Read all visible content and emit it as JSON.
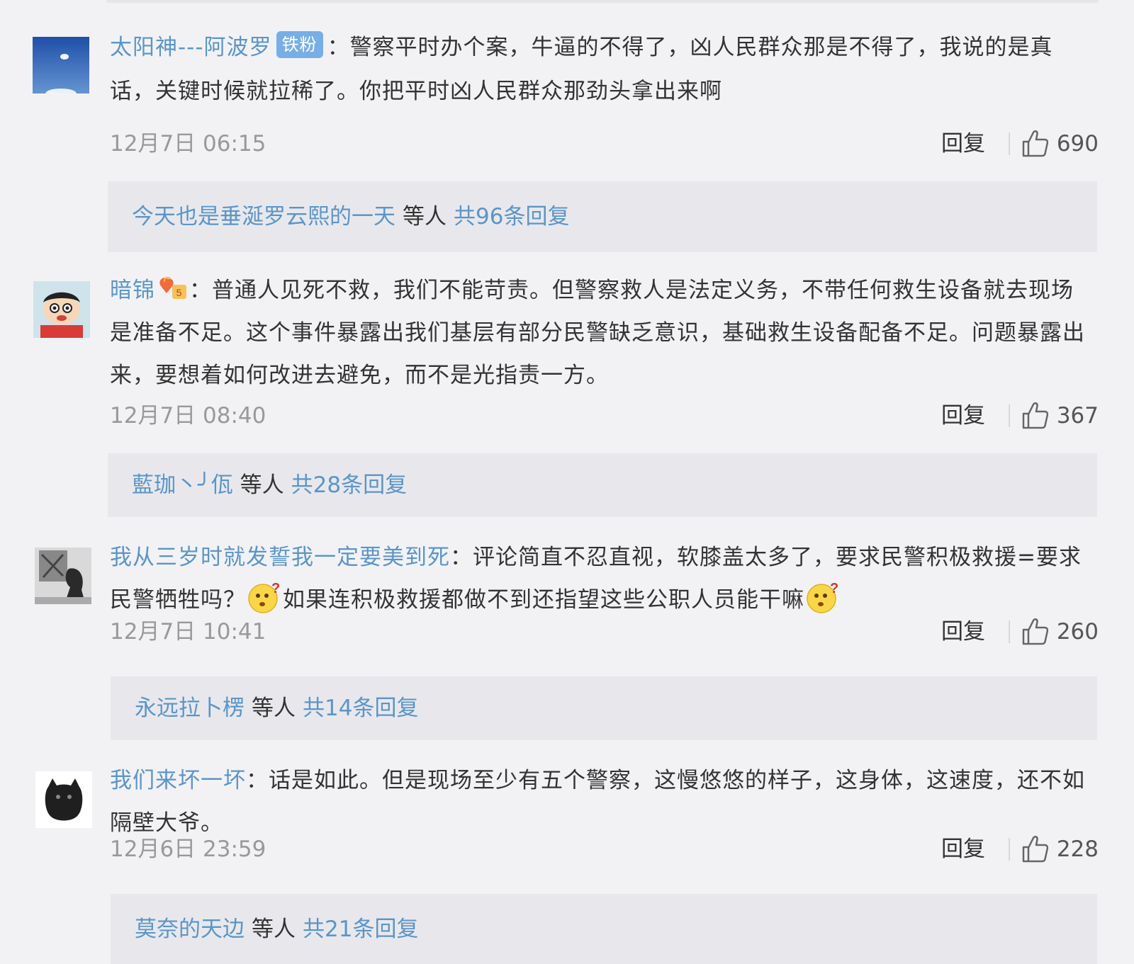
{
  "comments": [
    {
      "username": "太阳神---阿波罗",
      "badge": "铁粉",
      "colon": "：",
      "body": "警察平时办个案，牛逼的不得了，凶人民群众那是不得了，我说的是真话，关键时候就拉稀了。你把平时凶人民群众那劲头拿出来啊",
      "time": "12月7日 06:15",
      "reply_label": "回复",
      "likes": "690",
      "replies": {
        "replier": "今天也是垂涎罗云熙的一天",
        "etc": "等人",
        "total": "共96条回复"
      }
    },
    {
      "username": "暗锦",
      "colon": "：",
      "body": "普通人见死不救，我们不能苛责。但警察救人是法定义务，不带任何救生设备就去现场是准备不足。这个事件暴露出我们基层有部分民警缺乏意识，基础救生设备配备不足。问题暴露出来，要想着如何改进去避免，而不是光指责一方。",
      "time": "12月7日 08:40",
      "reply_label": "回复",
      "likes": "367",
      "replies": {
        "replier": "藍珈丶╯佤",
        "etc": "等人",
        "total": "共28条回复"
      }
    },
    {
      "username": "我从三岁时就发誓我一定要美到死",
      "colon": "：",
      "body_part1": "评论简直不忍直视，软膝盖太多了，要求民警积极救援=要求民警牺牲吗？",
      "body_part2": "如果连积极救援都做不到还指望这些公职人员能干嘛",
      "time": "12月7日 10:41",
      "reply_label": "回复",
      "likes": "260",
      "replies": {
        "replier": "永远拉卜楞",
        "etc": "等人",
        "total": "共14条回复"
      }
    },
    {
      "username": "我们来坏一坏",
      "colon": "：",
      "body": "话是如此。但是现场至少有五个警察，这慢悠悠的样子，这身体，这速度，还不如隔壁大爷。",
      "time": "12月6日 23:59",
      "reply_label": "回复",
      "likes": "228",
      "replies": {
        "replier": "莫奈的天边",
        "etc": "等人",
        "total": "共21条回复"
      }
    }
  ],
  "icons": {
    "vip": "vip-fan-icon",
    "emoji": "confused-face-emoji-icon",
    "like": "thumbs-up-icon"
  },
  "colors": {
    "link": "#5b95c9",
    "badge": "#78aee6",
    "background": "#f2f2f5",
    "reply_box": "#e8e8ec"
  }
}
